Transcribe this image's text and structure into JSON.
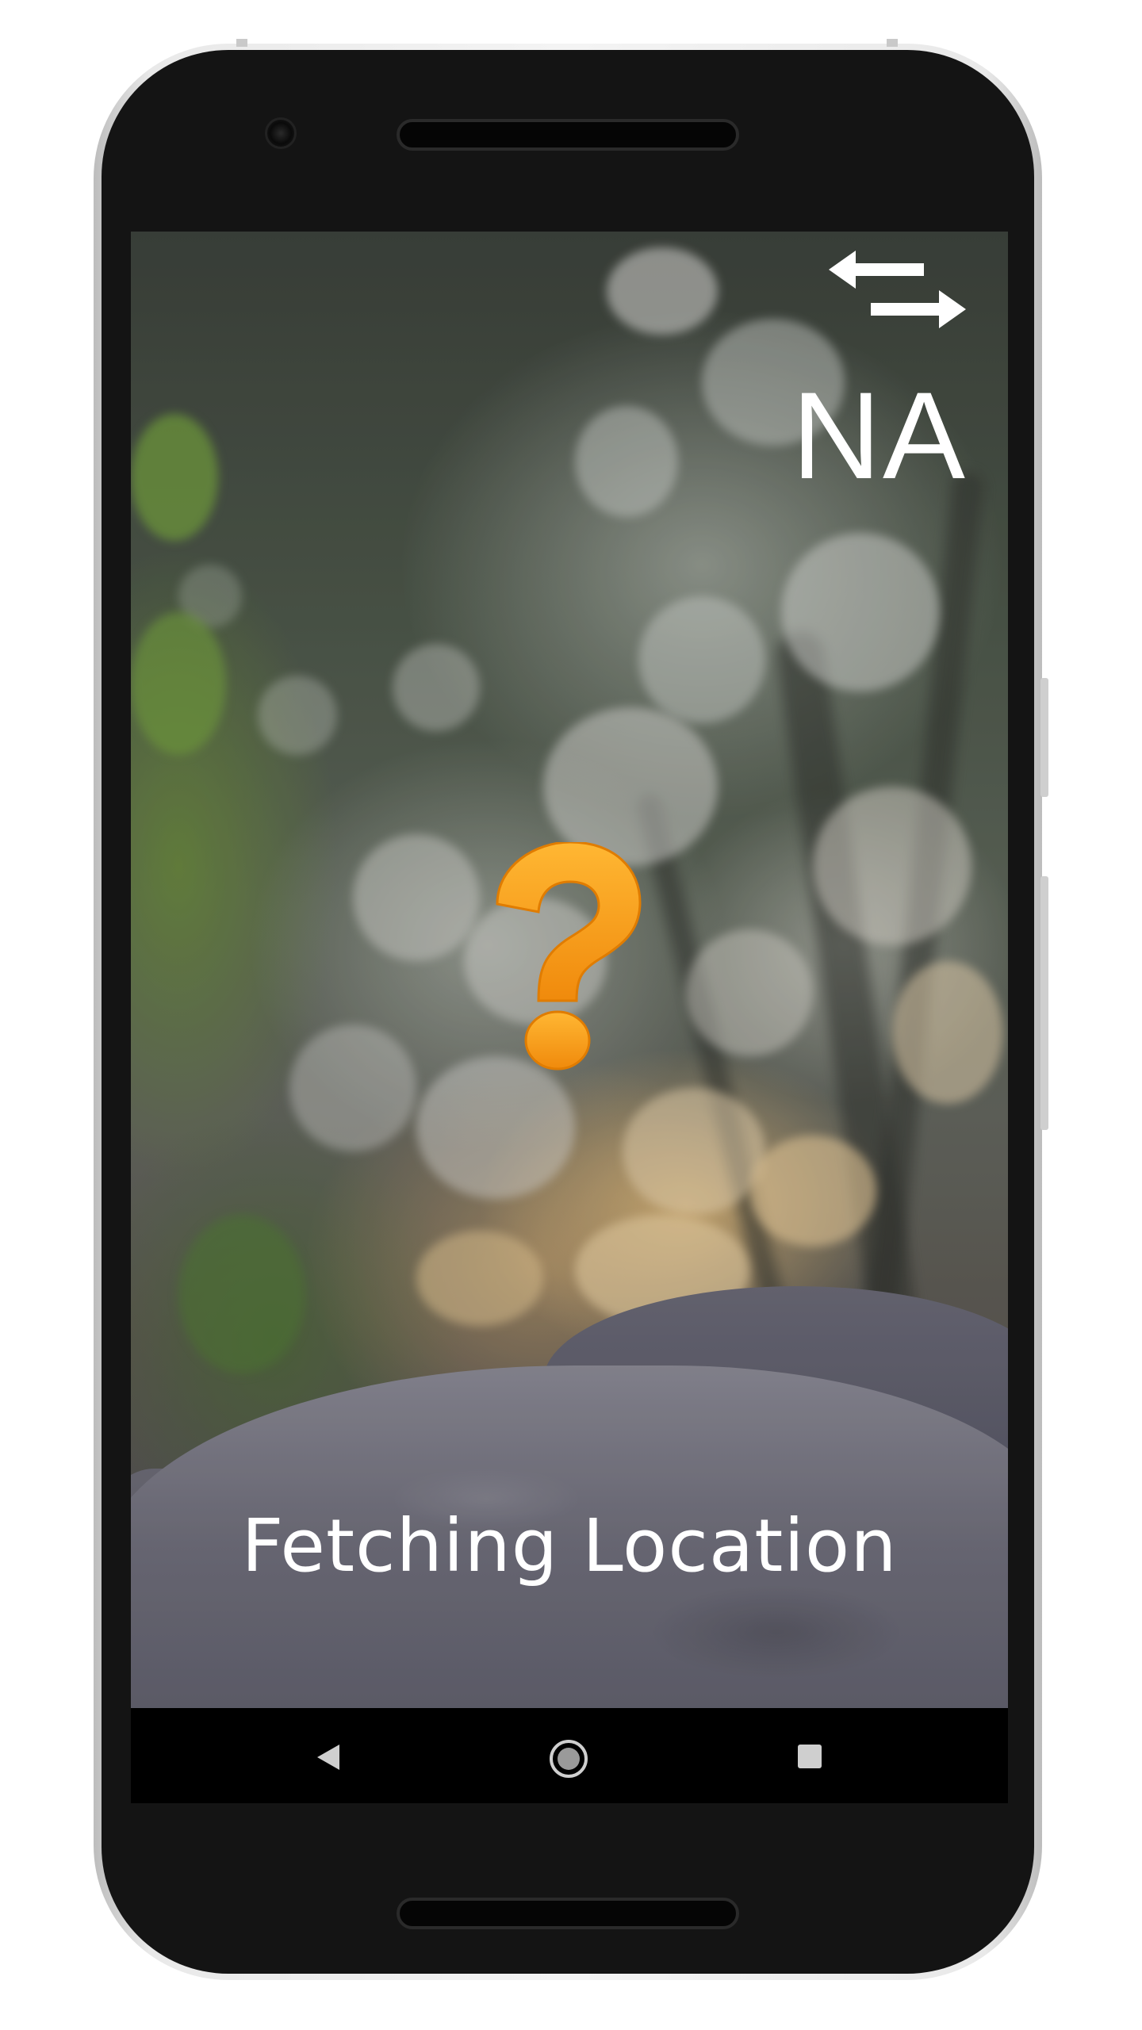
{
  "app": {
    "location_code": "NA",
    "status_text": "Fetching Location"
  },
  "icons": {
    "swap": "swap-arrows-icon",
    "status": "question-mark-icon",
    "back": "back-triangle-icon",
    "home": "home-circle-icon",
    "recents": "recents-square-icon"
  },
  "colors": {
    "question_mark": "#F7A21B",
    "text": "#FFFFFF",
    "navbar": "#000000"
  }
}
